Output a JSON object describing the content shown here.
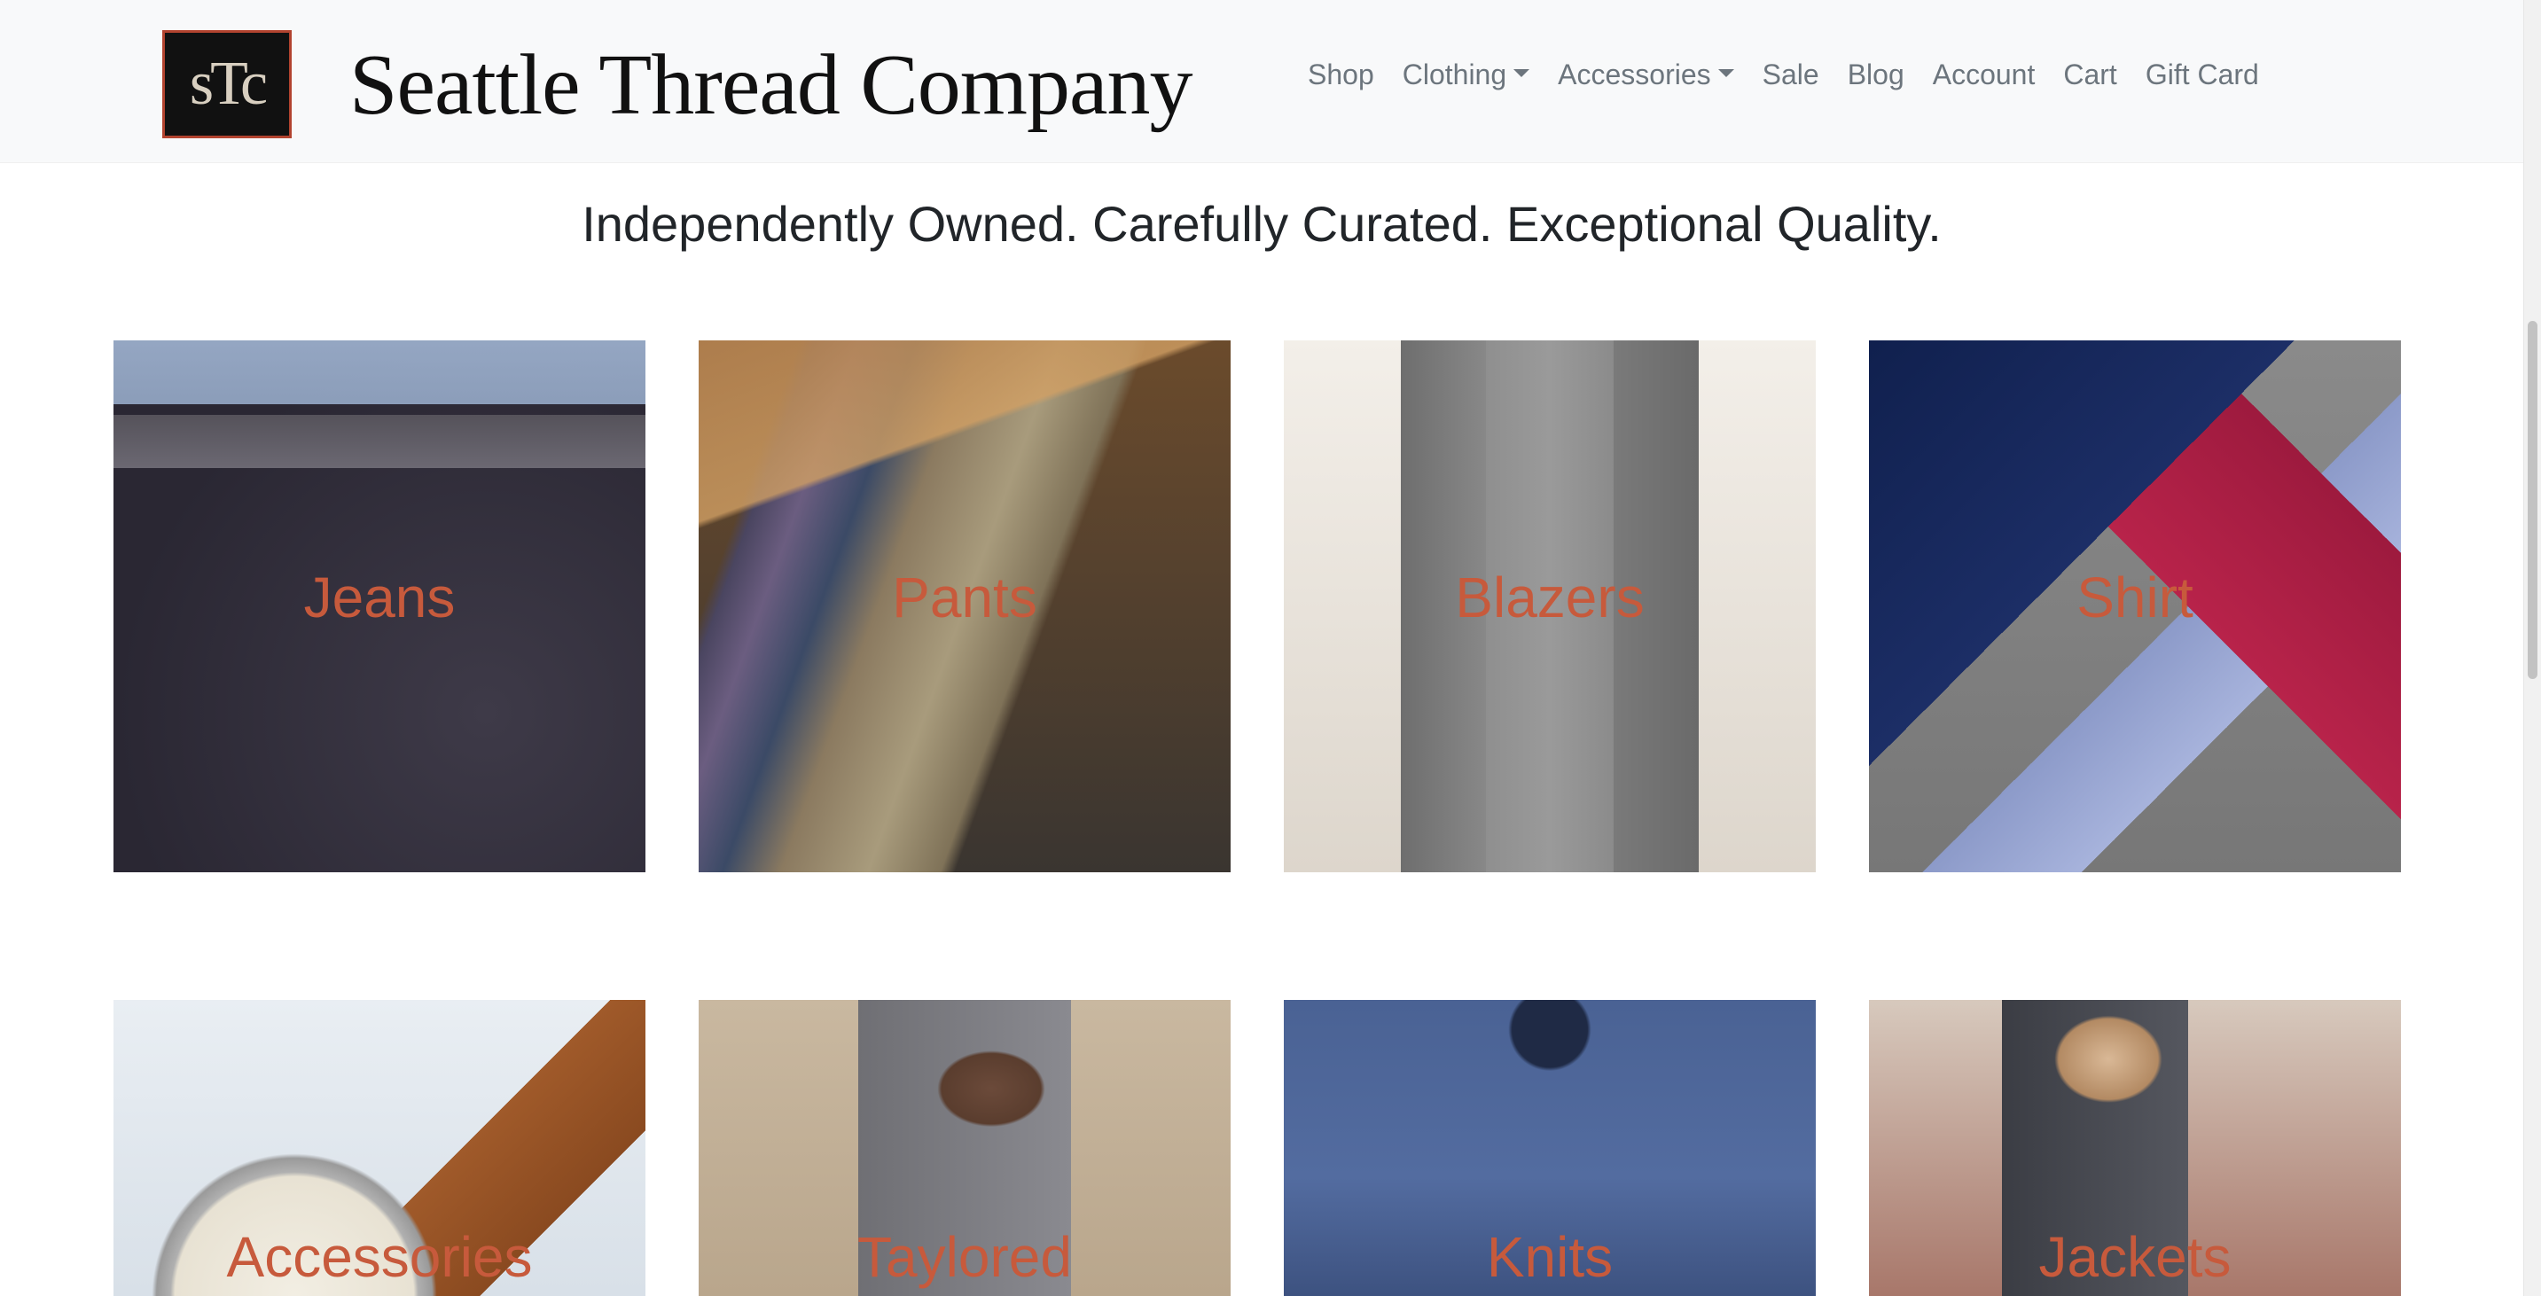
{
  "brand": {
    "logo_text": "sTc",
    "name": "Seattle Thread Company",
    "accent_color": "#b2432f"
  },
  "nav": {
    "items": [
      {
        "label": "Shop",
        "dropdown": false
      },
      {
        "label": "Clothing",
        "dropdown": true
      },
      {
        "label": "Accessories",
        "dropdown": true
      },
      {
        "label": "Sale",
        "dropdown": false
      },
      {
        "label": "Blog",
        "dropdown": false
      },
      {
        "label": "Account",
        "dropdown": false
      },
      {
        "label": "Cart",
        "dropdown": false
      },
      {
        "label": "Gift Card",
        "dropdown": false
      }
    ]
  },
  "tagline": "Independently Owned. Carefully Curated. Exceptional Quality.",
  "categories": [
    {
      "label": "Jeans",
      "image": "jeans-photo"
    },
    {
      "label": "Pants",
      "image": "pants-photo"
    },
    {
      "label": "Blazers",
      "image": "blazer-photo"
    },
    {
      "label": "Shirt",
      "image": "shirts-photo"
    },
    {
      "label": "Accessories",
      "image": "watch-photo"
    },
    {
      "label": "Taylored",
      "image": "tailored-vest-photo"
    },
    {
      "label": "Knits",
      "image": "knit-sweater-photo"
    },
    {
      "label": "Jackets",
      "image": "jacket-photo"
    }
  ],
  "category_label_color": "#c75a3c"
}
